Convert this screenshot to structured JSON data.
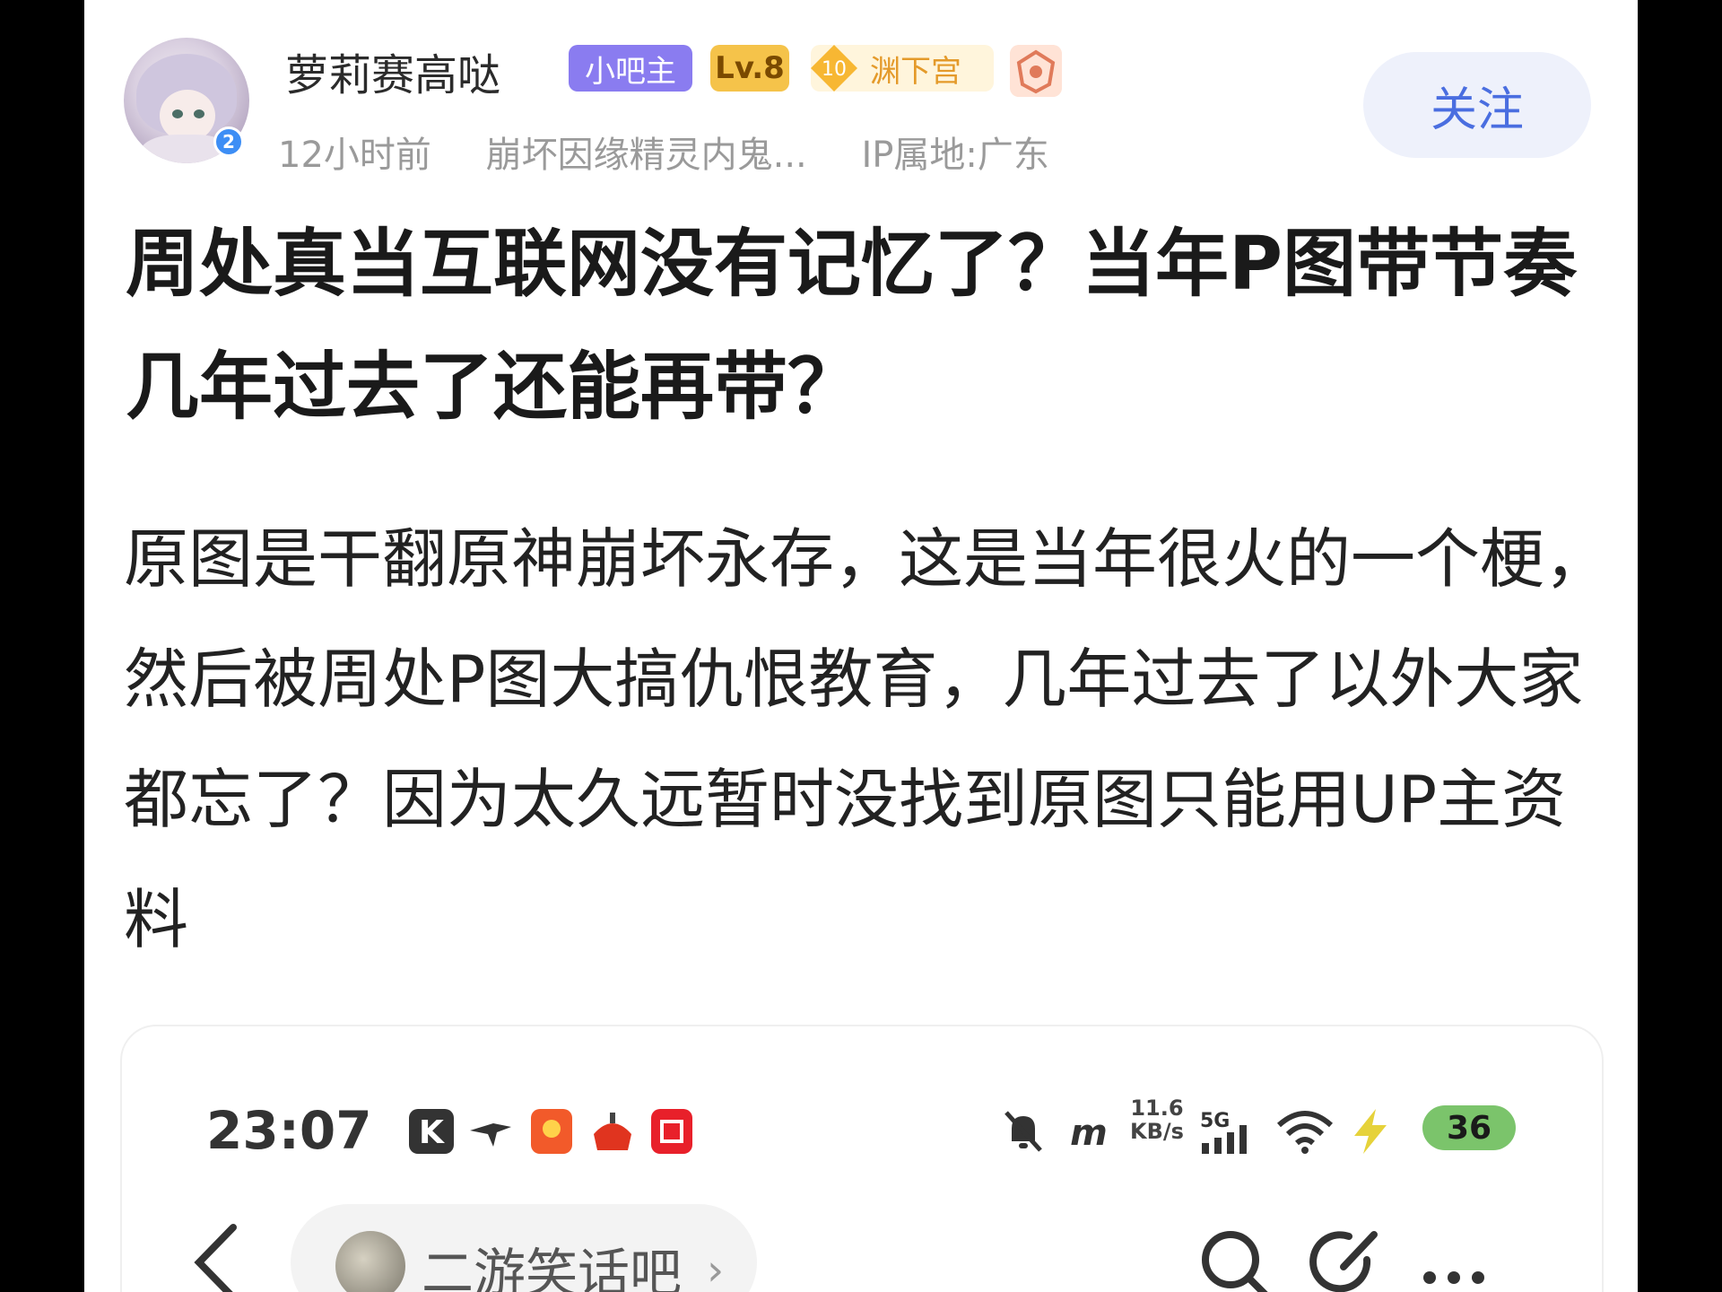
{
  "author": {
    "name": "萝莉赛高哒",
    "avatar_icon": "anime-girl-avatar",
    "level_dot": "2",
    "badges": {
      "owner": "小吧主",
      "level": "Lv.8",
      "title_coin": "10",
      "title": "渊下宫"
    }
  },
  "meta": {
    "time": "12小时前",
    "forum": "崩坏因缘精灵内鬼...",
    "ip": "IP属地:广东"
  },
  "follow_label": "关注",
  "post": {
    "title": "周处真当互联网没有记忆了？当年P图带节奏几年过去了还能再带？",
    "body": "原图是干翻原神崩坏永存，这是当年很火的一个梗，然后被周处P图大搞仇恨教育，几年过去了以外大家都忘了？因为太久远暂时没找到原图只能用UP主资料"
  },
  "embedded": {
    "status": {
      "time": "23:07",
      "net_speed_value": "11.6",
      "net_speed_unit": "KB/s",
      "net_type": "5G",
      "battery": "36"
    },
    "forum": {
      "name": "二游笑话吧",
      "chevron": "›"
    }
  },
  "colors": {
    "follow_text": "#4a6ee0",
    "owner_badge": "#8a7cf0",
    "level_badge": "#f5c34a",
    "battery": "#7bc46b"
  }
}
